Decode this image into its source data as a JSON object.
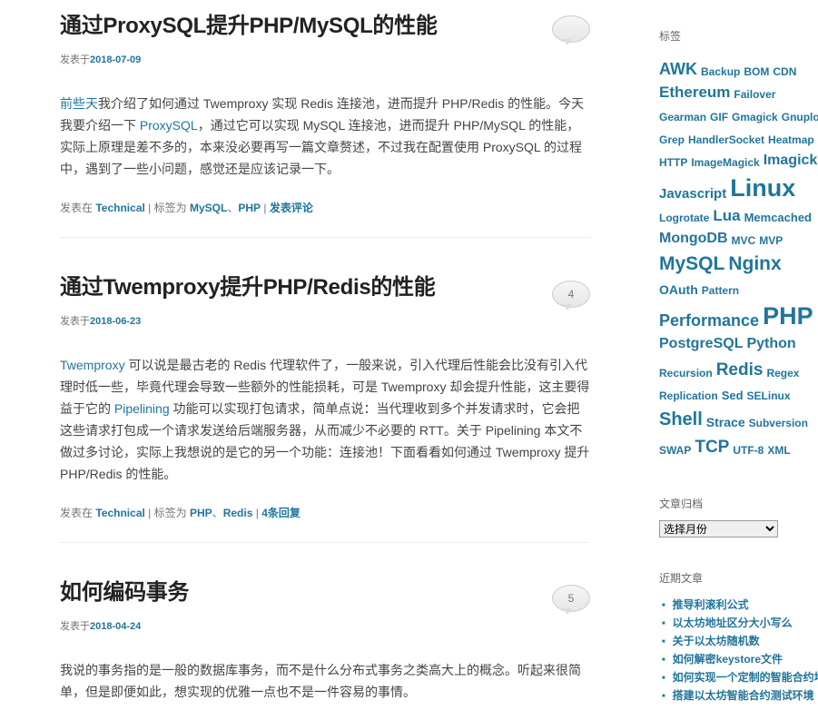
{
  "posts": [
    {
      "title": "通过ProxySQL提升PHP/MySQL的性能",
      "meta_prefix": "发表于",
      "date": "2018-07-09",
      "comment_count": "",
      "excerpt": [
        {
          "text": "前些天",
          "link": true
        },
        {
          "text": "我介绍了如何通过 Twemproxy 实现 Redis 连接池，进而提升 PHP/Redis 的性能。今天我要介绍一下 ",
          "link": false
        },
        {
          "text": "ProxySQL",
          "link": true
        },
        {
          "text": "，通过它可以实现 MySQL 连接池，进而提升 PHP/MySQL 的性能，实际上原理是差不多的，本来没必要再写一篇文章赘述，不过我在配置使用 ProxySQL 的过程中，遇到了一些小问题，感觉还是应该记录一下。",
          "link": false
        }
      ],
      "footer": {
        "posted_in": "发表在",
        "category": "Technical",
        "tagged": "标签为",
        "tags": [
          "MySQL",
          "PHP"
        ],
        "comment_link": "发表评论"
      }
    },
    {
      "title": "通过Twemproxy提升PHP/Redis的性能",
      "meta_prefix": "发表于",
      "date": "2018-06-23",
      "comment_count": "4",
      "excerpt": [
        {
          "text": "Twemproxy",
          "link": true
        },
        {
          "text": " 可以说是最古老的 Redis 代理软件了，一般来说，引入代理后性能会比没有引入代理时低一些，毕竟代理会导致一些额外的性能损耗，可是 Twemproxy 却会提升性能，这主要得益于它的 ",
          "link": false
        },
        {
          "text": "Pipelining",
          "link": true
        },
        {
          "text": " 功能可以实现打包请求，简单点说：当代理收到多个并发请求时，它会把这些请求打包成一个请求发送给后端服务器，从而减少不必要的 RTT。关于 Pipelining 本文不做过多讨论，实际上我想说的是它的另一个功能：连接池！下面看看如何通过 Twemproxy 提升 PHP/Redis 的性能。",
          "link": false
        }
      ],
      "footer": {
        "posted_in": "发表在",
        "category": "Technical",
        "tagged": "标签为",
        "tags": [
          "PHP",
          "Redis"
        ],
        "comment_link": "4条回复"
      }
    },
    {
      "title": "如何编码事务",
      "meta_prefix": "发表于",
      "date": "2018-04-24",
      "comment_count": "5",
      "excerpt": [
        {
          "text": "我说的事务指的是一般的数据库事务，而不是什么分布式事务之类高大上的概念。听起来很简单，但是即便如此，想实现的优雅一点也不是一件容易的事情。",
          "link": false
        }
      ]
    }
  ],
  "sidebar": {
    "tags_title": "标签",
    "tag_lines": [
      [
        [
          "AWK",
          18
        ],
        [
          "Backup",
          12
        ],
        [
          "BOM",
          12
        ],
        [
          "CDN",
          12
        ]
      ],
      [
        [
          "Ethereum",
          17
        ],
        [
          "Failover",
          12
        ]
      ],
      [
        [
          "Gearman",
          12
        ],
        [
          "GIF",
          12
        ],
        [
          "Gmagick",
          12
        ],
        [
          "Gnuplot",
          12
        ]
      ],
      [
        [
          "Grep",
          12
        ],
        [
          "HandlerSocket",
          12
        ],
        [
          "Heatmap",
          12
        ]
      ],
      [
        [
          "HTTP",
          12
        ],
        [
          "ImageMagick",
          12
        ],
        [
          "Imagick",
          16
        ]
      ],
      [
        [
          "Javascript",
          15
        ],
        [
          "Linux",
          27
        ]
      ],
      [
        [
          "Logrotate",
          12
        ],
        [
          "Lua",
          17
        ],
        [
          "Memcached",
          13
        ]
      ],
      [
        [
          "MongoDB",
          16
        ],
        [
          "MVC",
          12
        ],
        [
          "MVP",
          12
        ]
      ],
      [
        [
          "MySQL",
          21
        ],
        [
          "Nginx",
          21
        ]
      ],
      [
        [
          "OAuth",
          14
        ],
        [
          "Pattern",
          12
        ]
      ],
      [
        [
          "Performance",
          18
        ],
        [
          "PHP",
          27
        ]
      ],
      [
        [
          "PostgreSQL",
          16
        ],
        [
          "Python",
          16
        ]
      ],
      [
        [
          "Recursion",
          12
        ],
        [
          "Redis",
          19
        ],
        [
          "Regex",
          12
        ]
      ],
      [
        [
          "Replication",
          12
        ],
        [
          "Sed",
          13
        ],
        [
          "SELinux",
          12
        ]
      ],
      [
        [
          "Shell",
          20
        ],
        [
          "Strace",
          14
        ],
        [
          "Subversion",
          12
        ]
      ],
      [
        [
          "SWAP",
          12
        ],
        [
          "TCP",
          19
        ],
        [
          "UTF-8",
          12
        ],
        [
          "XML",
          12
        ]
      ]
    ],
    "archive_title": "文章归档",
    "archive_select": "选择月份",
    "recent_title": "近期文章",
    "recent_posts": [
      "推导利滚利公式",
      "以太坊地址区分大小写么",
      "关于以太坊随机数",
      "如何解密keystore文件",
      "如何实现一个定制的智能合约地址",
      "搭建以太坊智能合约测试环境"
    ]
  }
}
